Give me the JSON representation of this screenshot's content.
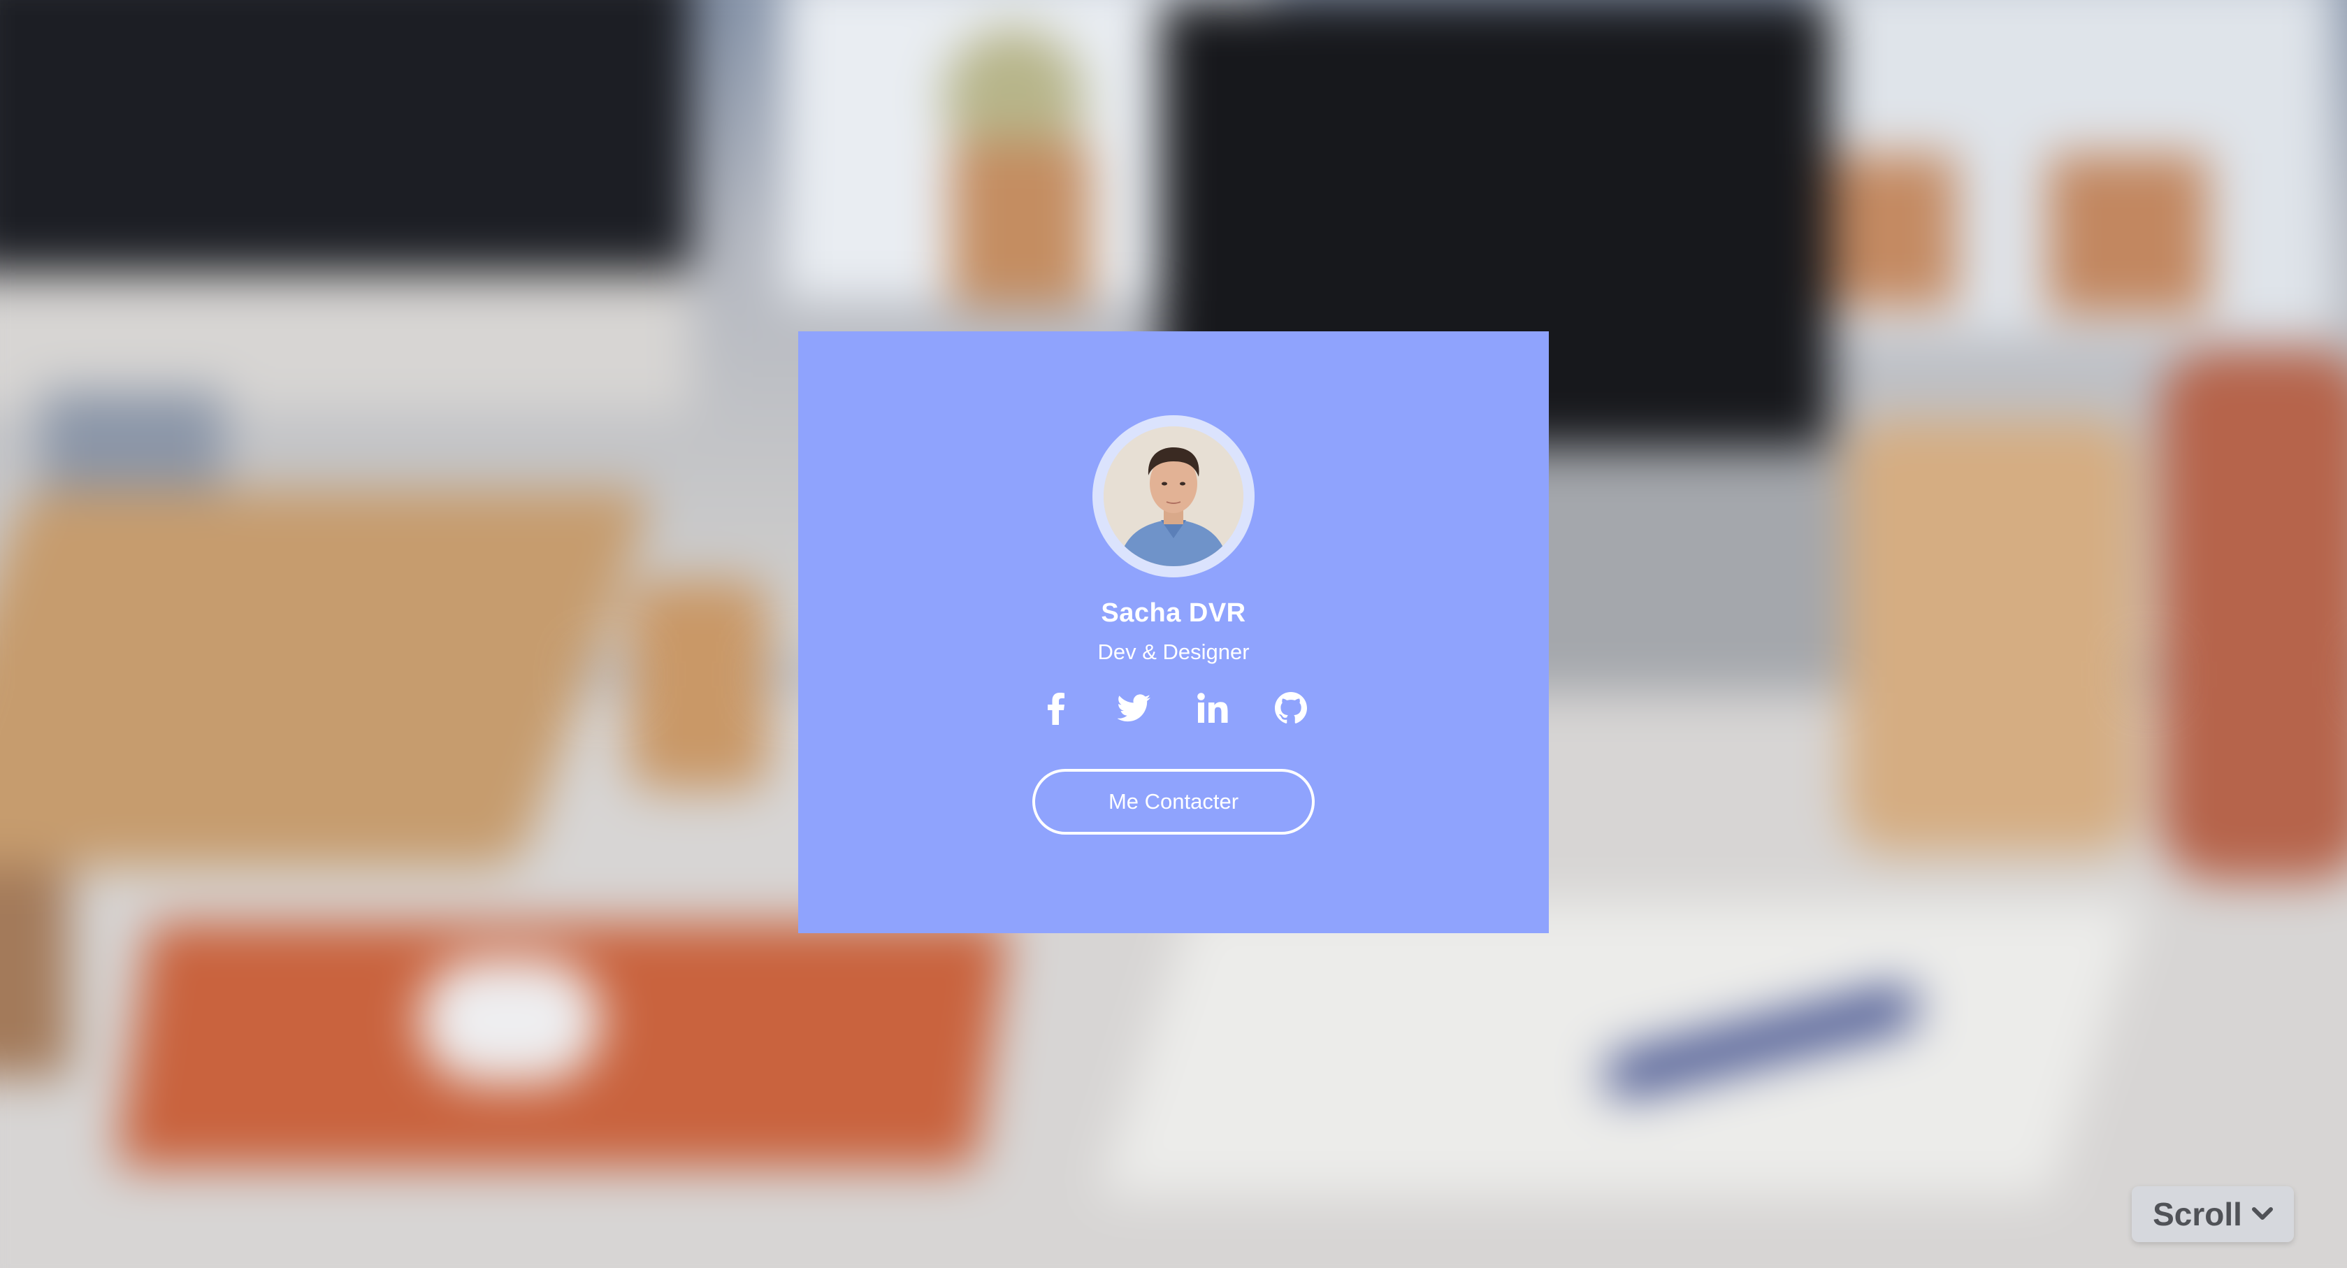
{
  "profile": {
    "name": "Sacha DVR",
    "role": "Dev & Designer",
    "avatar_alt": "Portrait photo"
  },
  "socials": [
    {
      "name": "facebook",
      "icon": "facebook-icon"
    },
    {
      "name": "twitter",
      "icon": "twitter-icon"
    },
    {
      "name": "linkedin",
      "icon": "linkedin-icon"
    },
    {
      "name": "github",
      "icon": "github-icon"
    }
  ],
  "actions": {
    "contact_label": "Me Contacter",
    "scroll_label": "Scroll"
  },
  "colors": {
    "card": "#8fa3fd",
    "avatar_ring": "#dbe3fd",
    "text": "#ffffff",
    "scroll_bg": "#d6d8de",
    "scroll_text": "#505257"
  }
}
